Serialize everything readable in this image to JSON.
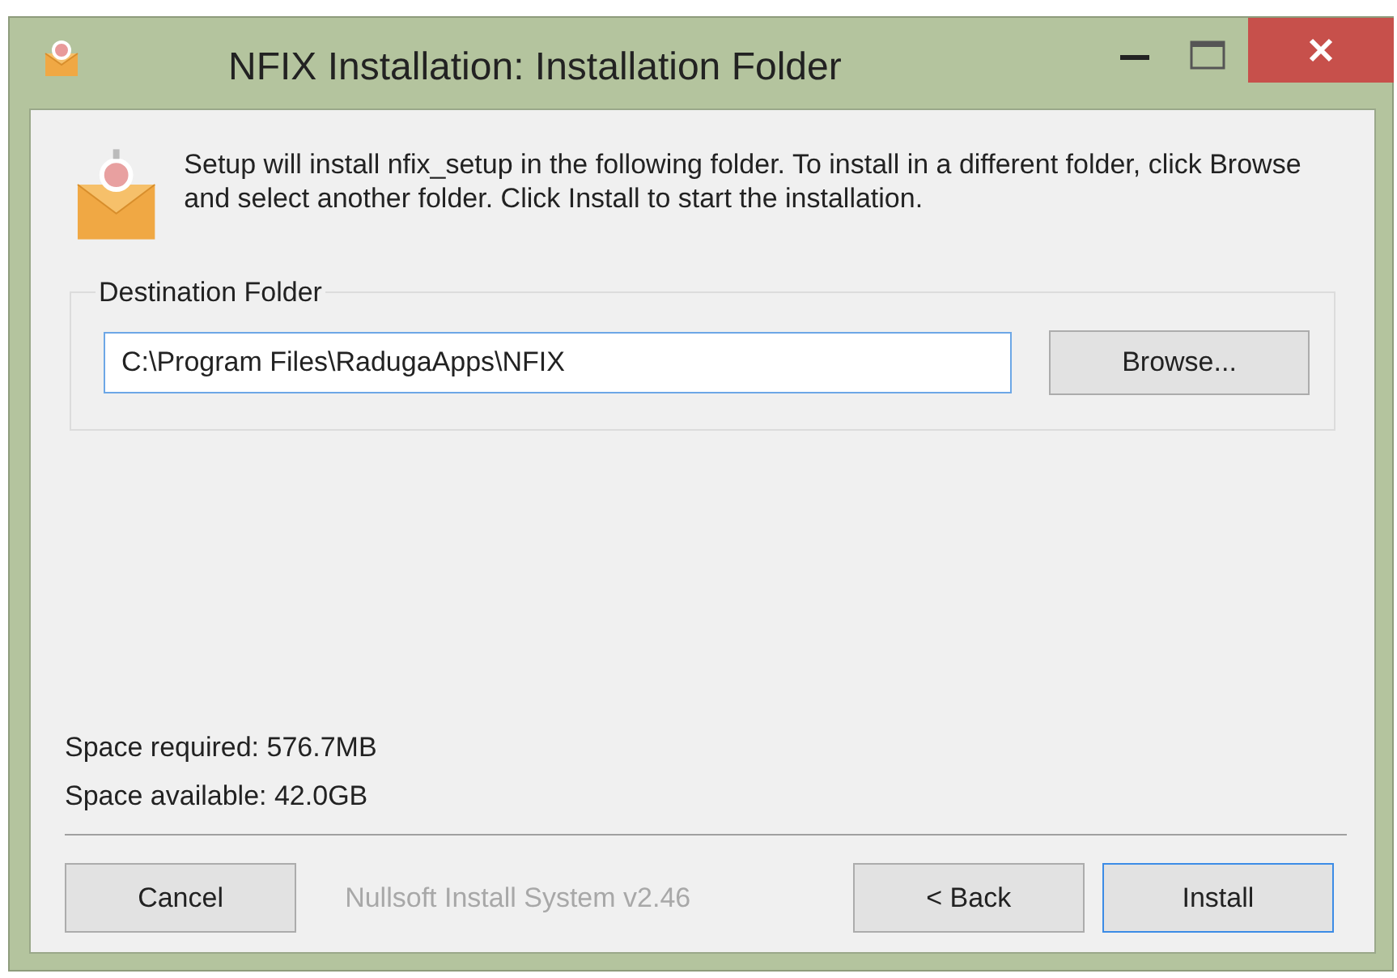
{
  "window": {
    "title": "NFIX Installation: Installation Folder"
  },
  "intro": "Setup will install nfix_setup in the following folder. To install in a different folder, click Browse and select another folder. Click Install to start the installation.",
  "destination": {
    "label": "Destination Folder",
    "value": "C:\\Program Files\\RadugaApps\\NFIX",
    "browse": "Browse..."
  },
  "space": [
    "Space required: 576.7MB",
    "Space available: 42.0GB"
  ],
  "branding": {
    "text": "Nullsoft Install System v2.46",
    "disabled": true
  },
  "buttons": [
    {
      "label": "Cancel",
      "default": false
    },
    {
      "label": "< Back",
      "default": false
    },
    {
      "label": "Install",
      "default": true
    }
  ]
}
